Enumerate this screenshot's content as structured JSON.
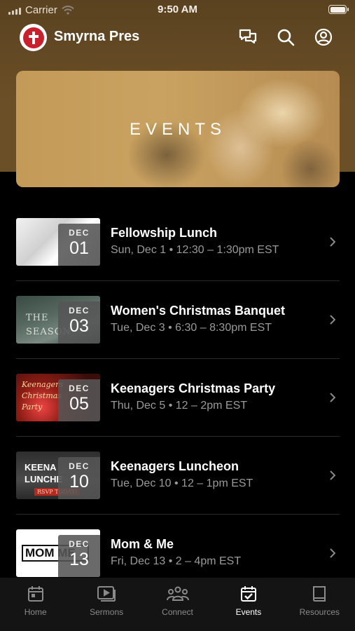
{
  "status": {
    "carrier": "Carrier",
    "time": "9:50 AM"
  },
  "app": {
    "title": "Smyrna Pres"
  },
  "banner": {
    "title": "EVENTS"
  },
  "events": [
    {
      "month": "DEC",
      "day": "01",
      "title": "Fellowship Lunch",
      "subtitle": "Sun, Dec 1 • 12:30 – 1:30pm EST"
    },
    {
      "month": "DEC",
      "day": "03",
      "title": "Women's Christmas Banquet",
      "subtitle": "Tue, Dec 3 • 6:30 – 8:30pm EST",
      "thumb_text": "THE SEASON"
    },
    {
      "month": "DEC",
      "day": "05",
      "title": "Keenagers Christmas Party",
      "subtitle": "Thu, Dec 5 • 12 – 2pm EST",
      "thumb_text": "Keenagers Christmas Party"
    },
    {
      "month": "DEC",
      "day": "10",
      "title": "Keenagers Luncheon",
      "subtitle": "Tue, Dec 10 • 12 – 1pm EST",
      "thumb_text": "KEENA LUNCHE",
      "thumb_badge": "RSVP TODAY!"
    },
    {
      "month": "DEC",
      "day": "13",
      "title": "Mom & Me",
      "subtitle": "Fri, Dec 13 • 2 – 4pm EST",
      "thumb_text": "MOM ME"
    }
  ],
  "tabs": [
    {
      "label": "Home",
      "icon": "calendar-icon"
    },
    {
      "label": "Sermons",
      "icon": "play-icon"
    },
    {
      "label": "Connect",
      "icon": "people-icon"
    },
    {
      "label": "Events",
      "icon": "calendar-check-icon"
    },
    {
      "label": "Resources",
      "icon": "book-icon"
    }
  ],
  "active_tab": "Events",
  "colors": {
    "header_brown": "#6b4f27",
    "logo_red": "#c8202c",
    "background": "#000000"
  }
}
